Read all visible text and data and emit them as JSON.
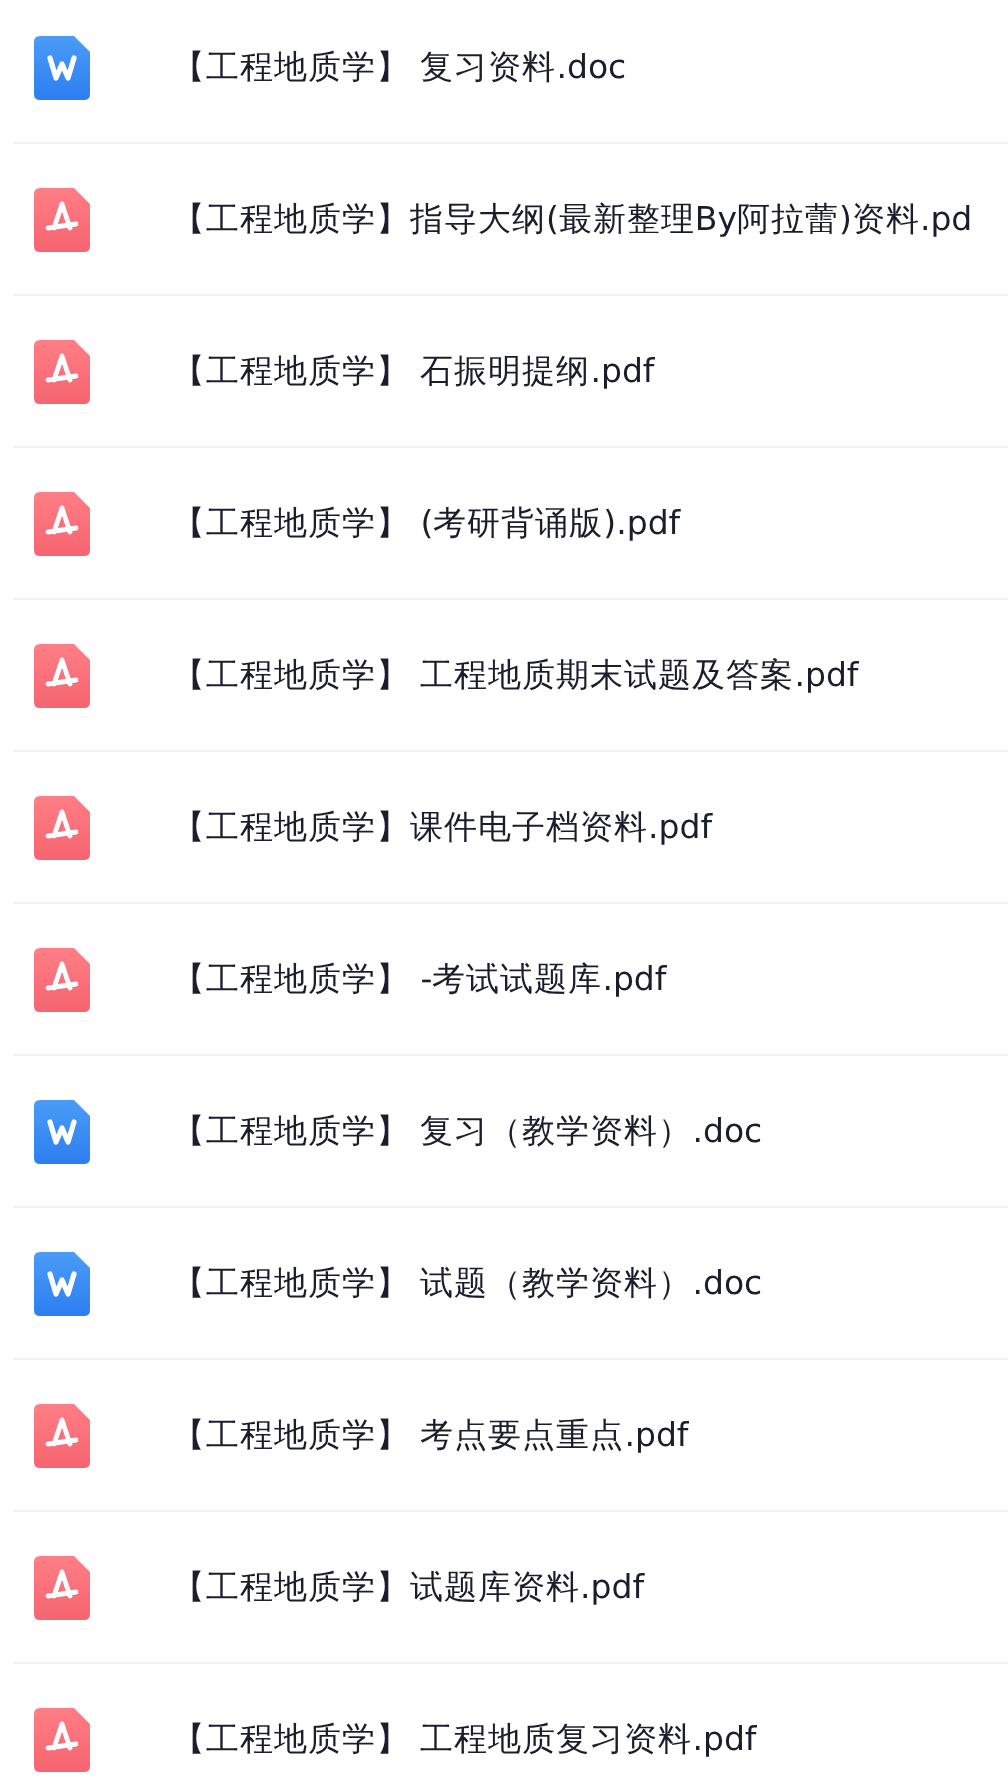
{
  "files": [
    {
      "kind": "doc",
      "name": "【工程地质学】 复习资料.doc"
    },
    {
      "kind": "pdf",
      "name": "【工程地质学】指导大纲(最新整理By阿拉蕾)资料.pd"
    },
    {
      "kind": "pdf",
      "name": "【工程地质学】 石振明提纲.pdf"
    },
    {
      "kind": "pdf",
      "name": "【工程地质学】 (考研背诵版).pdf"
    },
    {
      "kind": "pdf",
      "name": "【工程地质学】 工程地质期末试题及答案.pdf"
    },
    {
      "kind": "pdf",
      "name": "【工程地质学】课件电子档资料.pdf"
    },
    {
      "kind": "pdf",
      "name": "【工程地质学】 -考试试题库.pdf"
    },
    {
      "kind": "doc",
      "name": "【工程地质学】 复习（教学资料）.doc"
    },
    {
      "kind": "doc",
      "name": "【工程地质学】 试题（教学资料）.doc"
    },
    {
      "kind": "pdf",
      "name": "【工程地质学】 考点要点重点.pdf"
    },
    {
      "kind": "pdf",
      "name": "【工程地质学】试题库资料.pdf"
    },
    {
      "kind": "pdf",
      "name": "【工程地质学】 工程地质复习资料.pdf"
    }
  ]
}
